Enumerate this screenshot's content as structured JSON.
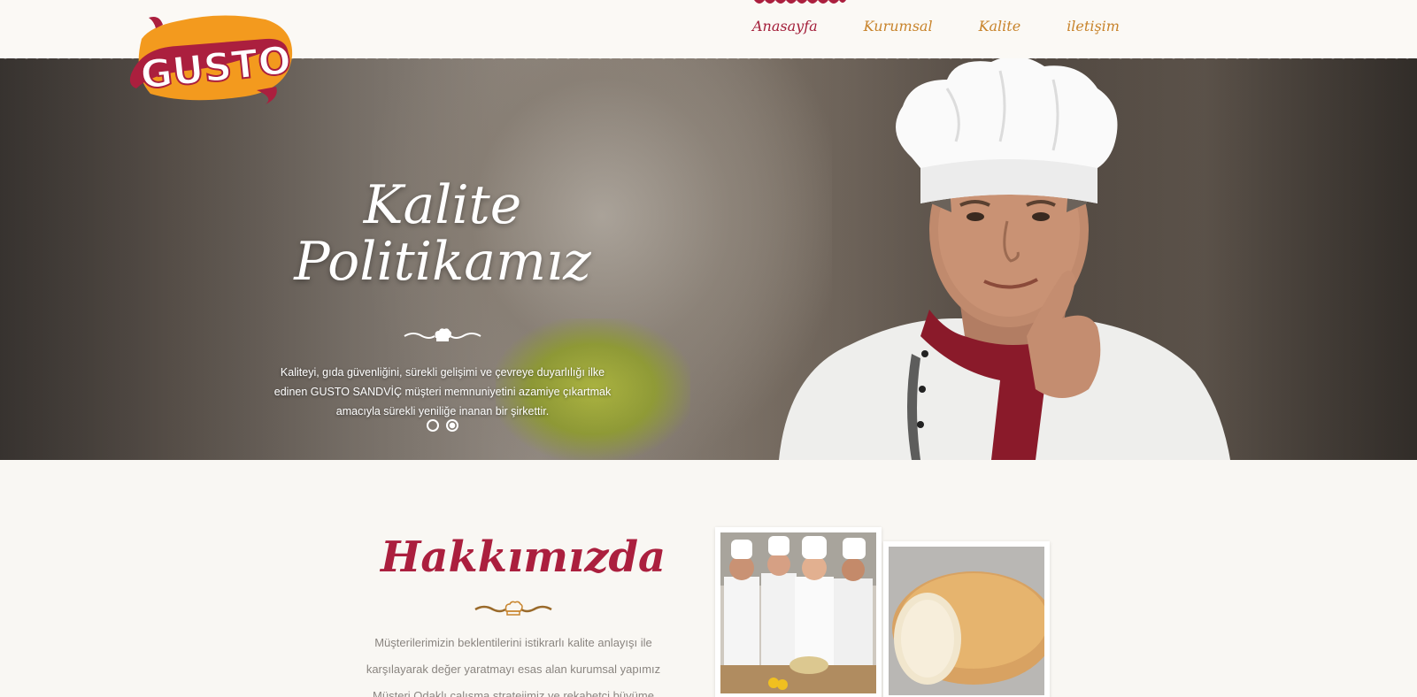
{
  "brand": {
    "logo_text": "GUSTO"
  },
  "nav": {
    "items": [
      {
        "label": "Anasayfa"
      },
      {
        "label": "Kurumsal"
      },
      {
        "label": "Kalite"
      },
      {
        "label": "iletişim"
      }
    ]
  },
  "hero": {
    "title_line1": "Kalite",
    "title_line2": "Politikamız",
    "description": "Kaliteyi, gıda güvenliğini, sürekli gelişimi ve çevreye duyarlılığı ilke edinen GUSTO SANDVİÇ müşteri memnuniyetini azamiye çıkartmak amacıyla sürekli yeniliğe inanan bir şirkettir.",
    "slides": 2,
    "active_slide": 2
  },
  "about": {
    "title": "Hakkımızda",
    "text": "Müşterilerimizin beklentilerini istikrarlı kalite anlayışı ile karşılayarak değer yaratmayı esas alan kurumsal yapımız Müşteri Odaklı çalışma stratejimiz ve rekabetçi büyüme"
  },
  "colors": {
    "brand_red": "#ab1f3e",
    "nav_gold": "#c8842c",
    "logo_orange": "#f39a1e",
    "background": "#f9f7f3"
  },
  "icons": {
    "ornament": "chef-hat-divider-icon",
    "slider_dot": "slider-dot-icon"
  }
}
